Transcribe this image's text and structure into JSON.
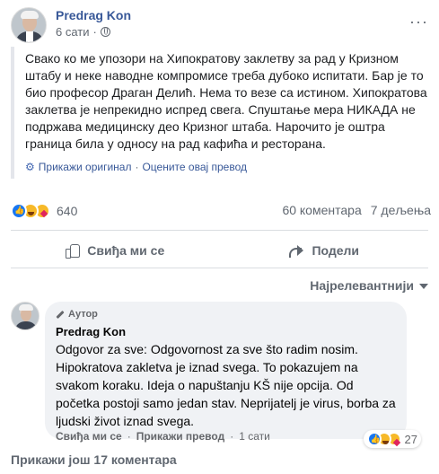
{
  "post": {
    "author": "Predrag Kon",
    "time": "6 сати",
    "dot": "·",
    "privacy_icon": "globe-icon",
    "more_icon": "···",
    "text": "Свако ко ме упозори на Хипократову заклетву за рад у Кризном штабу и неке наводне компромисе треба дубоко испитати. Бар је то био професор Драган Делић. Нема то везе са истином. Хипократова заклетва је непрекидно испред свега. Спуштање мера НИКАДА не подржава медицинску део Кризног штаба. Нарочито је оштра граница била у односу на рад кафића и ресторана.",
    "show_original": "Прикажи оригинал",
    "rate_translation": "Оцените овај превод",
    "translate_sep": "·"
  },
  "stats": {
    "reaction_icons": [
      "like",
      "haha",
      "care"
    ],
    "reaction_count": "640",
    "comments": "60 коментара",
    "shares": "7 дељења"
  },
  "actions": {
    "like": "Свиђа ми се",
    "share": "Подели"
  },
  "sort": {
    "label": "Најрелевантнији"
  },
  "comment": {
    "badge": "Аутор",
    "author": "Predrag Kon",
    "text": "Odgovor za sve: Odgovornost za sve što radim nosim. Hipokratova zakletva je iznad svega. To pokazujem na svakom koraku. Ideja o napuštanju KŠ nije opcija. Od početka postoji samo jedan stav. Neprijatelj je virus, borba za ljudski život iznad svega.",
    "reaction_count": "27",
    "like": "Свиђа ми се",
    "show_translation": "Прикажи превод",
    "time": "1 сати",
    "sep": "·"
  },
  "more_comments": "Прикажи још 17 коментара",
  "colors": {
    "link": "#385898",
    "muted": "#606770",
    "bubble": "#f0f2f5",
    "like_blue": "#1877f2",
    "emoji_yellow": "#f7b928"
  }
}
